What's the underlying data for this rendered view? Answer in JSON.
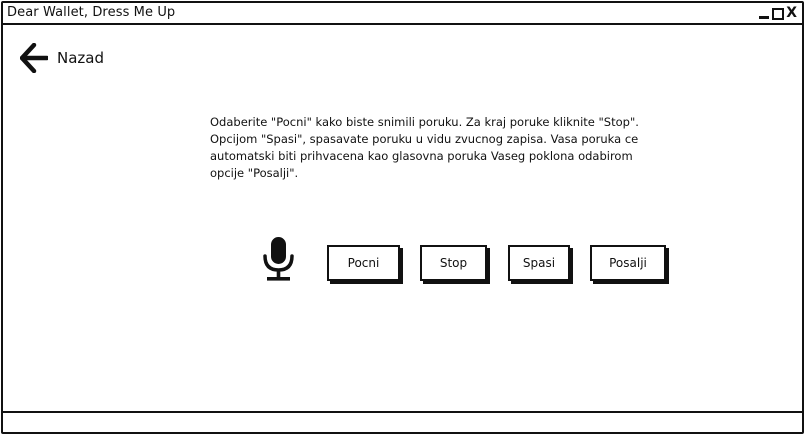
{
  "window": {
    "title": "Dear Wallet, Dress Me Up",
    "controls": {
      "minimize": "_",
      "maximize": "□",
      "close": "X"
    }
  },
  "nav": {
    "back_icon": "arrow-left-icon",
    "back_label": "Nazad"
  },
  "content": {
    "message": "Odaberite \"Pocni\" kako biste snimili poruku. Za kraj poruke kliknite \"Stop\". Opcijom \"Spasi\", spasavate poruku u vidu zvucnog zapisa. Vasa poruka ce automatski biti prihvacena kao glasovna poruka Vaseg poklona odabirom opcije \"Posalji\".",
    "mic_icon": "microphone-icon"
  },
  "actions": {
    "pocni": "Pocni",
    "stop": "Stop",
    "spasi": "Spasi",
    "posalji": "Posalji"
  },
  "statusbar": {
    "text": ""
  }
}
